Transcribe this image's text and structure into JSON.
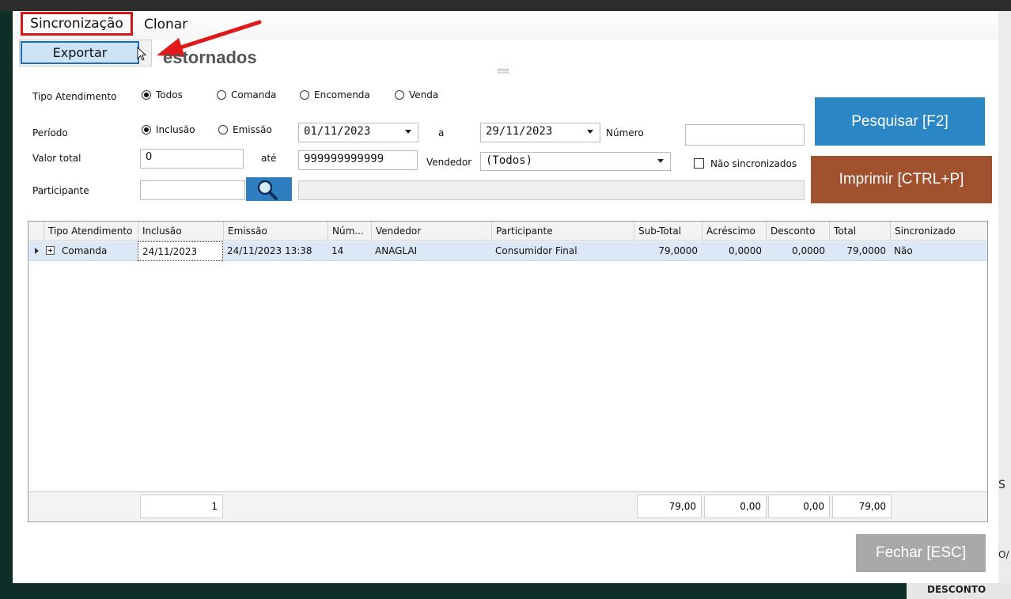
{
  "menu": {
    "sync_label": "Sincronização",
    "clonar_label": "Clonar",
    "export_label": "Exportar"
  },
  "page": {
    "title_partial": "estornados"
  },
  "filters": {
    "tipo_label": "Tipo Atendimento",
    "tipo_options": [
      "Todos",
      "Comanda",
      "Encomenda",
      "Venda"
    ],
    "tipo_selected": "Todos",
    "periodo_label": "Período",
    "periodo_options": [
      "Inclusão",
      "Emissão"
    ],
    "periodo_selected": "Inclusão",
    "date_from": "01/11/2023",
    "a_label": "a",
    "date_to": "29/11/2023",
    "numero_label": "Número",
    "numero_value": "",
    "valor_label": "Valor total",
    "valor_min": "0",
    "ate_label": "até",
    "valor_max": "999999999999",
    "vendedor_label": "Vendedor",
    "vendedor_value": "(Todos)",
    "nao_sync_label": "Não sincronizados",
    "nao_sync_checked": false,
    "participante_label": "Participante",
    "participante_value": ""
  },
  "buttons": {
    "pesquisar": "Pesquisar [F2]",
    "imprimir": "Imprimir [CTRL+P]",
    "fechar": "Fechar [ESC]"
  },
  "colors": {
    "pesquisar": "#2b86c6",
    "imprimir": "#a0512e",
    "fechar": "#a9a9a9",
    "highlight": "#d51616"
  },
  "grid": {
    "columns": [
      "Tipo Atendimento",
      "Inclusão",
      "Emissão",
      "Núm...",
      "Vendedor",
      "Participante",
      "Sub-Total",
      "Acréscimo",
      "Desconto",
      "Total",
      "Sincronizado"
    ],
    "rows": [
      {
        "tipo": "Comanda",
        "inclusao": "24/11/2023",
        "emissao": "24/11/2023 13:38",
        "numero": "14",
        "vendedor": "ANAGLAI",
        "participante": "Consumidor Final",
        "subtotal": "79,0000",
        "acrescimo": "0,0000",
        "desconto": "0,0000",
        "total": "79,0000",
        "sincronizado": "Não"
      }
    ],
    "footer": {
      "count": "1",
      "subtotal": "79,00",
      "acrescimo": "0,00",
      "desconto": "0,00",
      "total": "79,00"
    }
  },
  "background": {
    "desconto_label": "DESCONTO",
    "s_fragment": "S",
    "o_fragment": "O/"
  }
}
